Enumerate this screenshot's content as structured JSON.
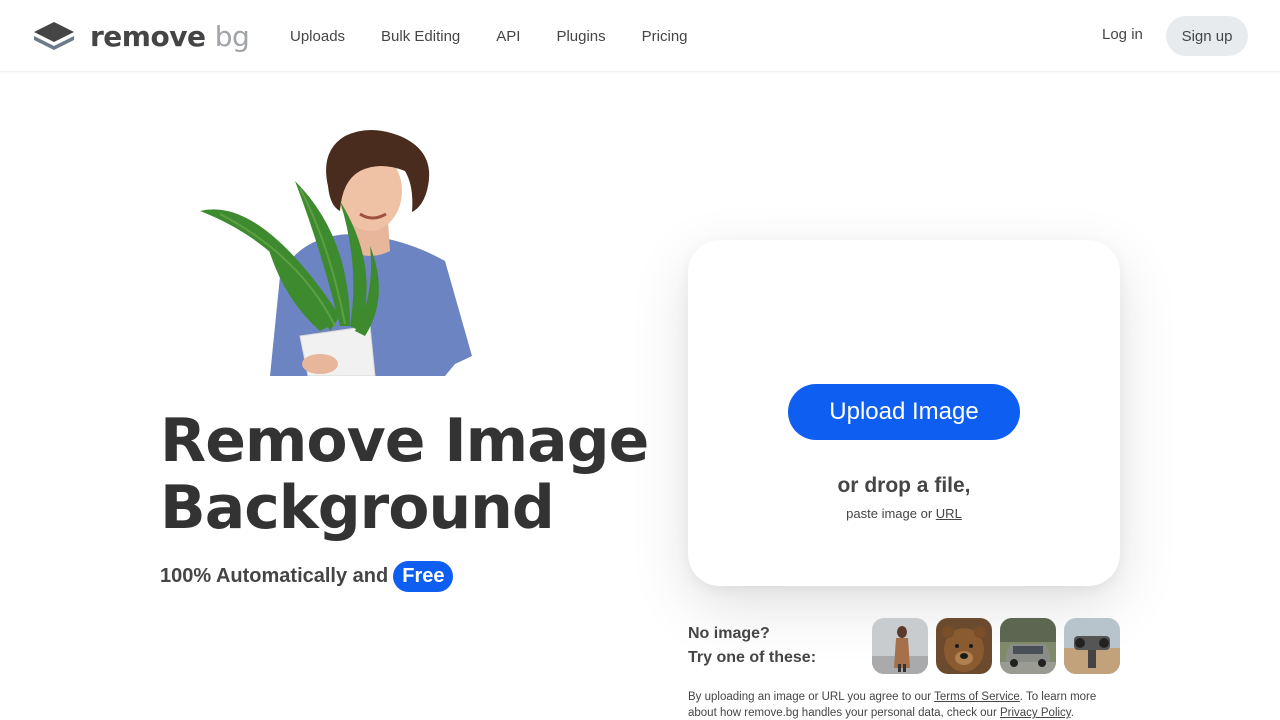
{
  "header": {
    "logo_text": "remove",
    "logo_text_suffix": "bg",
    "nav": [
      {
        "label": "Uploads"
      },
      {
        "label": "Bulk Editing"
      },
      {
        "label": "API"
      },
      {
        "label": "Plugins"
      },
      {
        "label": "Pricing"
      }
    ],
    "login_label": "Log in",
    "signup_label": "Sign up"
  },
  "hero": {
    "title_line1": "Remove Image",
    "title_line2": "Background",
    "subtitle": "100% Automatically and",
    "badge": "Free"
  },
  "upload": {
    "button_label": "Upload Image",
    "drop_text": "or drop a file,",
    "paste_prefix": "paste image or",
    "url_link": "URL"
  },
  "samples": {
    "line1": "No image?",
    "line2": "Try one of these:",
    "items": [
      {
        "name": "woman-sample"
      },
      {
        "name": "bear-sample"
      },
      {
        "name": "car-sample"
      },
      {
        "name": "binoculars-sample"
      }
    ]
  },
  "legal": {
    "prefix": "By uploading an image or URL you agree to our",
    "tos": "Terms of Service",
    "middle": ". To learn more about how remove.bg handles your personal data, check our",
    "privacy": "Privacy Policy",
    "suffix": "."
  },
  "colors": {
    "accent": "#0f5ef2",
    "text": "#454545",
    "signup_bg": "#e8ebee"
  }
}
